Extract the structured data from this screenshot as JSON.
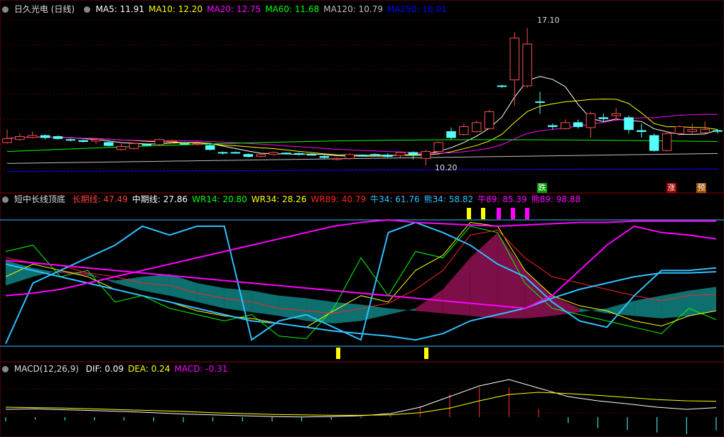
{
  "colors": {
    "ma5": "#ffffff",
    "ma10": "#ffff00",
    "ma20": "#ff00ff",
    "ma60": "#00ff00",
    "ma120": "#c0c0c0",
    "ma250": "#0000ff",
    "up": "#ff5050",
    "down": "#54ffff",
    "grid": "#5a0000",
    "frame": "#8a0000"
  },
  "panel1": {
    "title": "日久光电 (日线)",
    "legend": [
      {
        "label": "MA5: 11.91",
        "color": "#ffffff"
      },
      {
        "label": "MA10: 12.20",
        "color": "#ffff00"
      },
      {
        "label": "MA20: 12.75",
        "color": "#ff00ff"
      },
      {
        "label": "MA60: 11.68",
        "color": "#00ff00"
      },
      {
        "label": "MA120: 10.79",
        "color": "#c0c0c0"
      },
      {
        "label": "MA250: 10.01",
        "color": "#0000ff"
      }
    ],
    "high_label": "17.10",
    "low_label": "10.20",
    "signals": [
      {
        "text": "跌",
        "bg": "#00a000"
      },
      {
        "text": "涨",
        "bg": "#a00000"
      },
      {
        "text": "预",
        "bg": "#a05000"
      }
    ]
  },
  "panel2": {
    "title": "短中长线顶底",
    "legend": [
      {
        "label": "长期线: 47.49",
        "color": "#ff4040"
      },
      {
        "label": "中期线: 27.86",
        "color": "#ffffff"
      },
      {
        "label": "WR14: 20.80",
        "color": "#00ff00"
      },
      {
        "label": "WR34: 28.26",
        "color": "#ffff00"
      },
      {
        "label": "WR89: 40.79",
        "color": "#ff2020"
      },
      {
        "label": "牛34: 61.76",
        "color": "#30c0ff"
      },
      {
        "label": "熊34: 58.82",
        "color": "#30c0ff"
      },
      {
        "label": "牛89: 85.39",
        "color": "#ff00ff"
      },
      {
        "label": "熊89: 98.88",
        "color": "#ff00ff"
      }
    ]
  },
  "panel3": {
    "title": "MACD(12,26,9)",
    "legend": [
      {
        "label": "DIF: 0.09",
        "color": "#ffffff"
      },
      {
        "label": "DEA: 0.24",
        "color": "#ffff00"
      },
      {
        "label": "MACD: -0.31",
        "color": "#ff00ff"
      }
    ]
  },
  "chart_data": [
    {
      "type": "candlestick",
      "title": "日久光电 (日线)",
      "ylim": [
        9.6,
        17.8
      ],
      "candles": [
        {
          "o": 11.35,
          "c": 11.55,
          "h": 12.0,
          "l": 11.3
        },
        {
          "o": 11.5,
          "c": 11.65,
          "h": 11.8,
          "l": 11.45
        },
        {
          "o": 11.6,
          "c": 11.7,
          "h": 11.9,
          "l": 11.55
        },
        {
          "o": 11.7,
          "c": 11.6,
          "h": 11.75,
          "l": 11.5
        },
        {
          "o": 11.65,
          "c": 11.55,
          "h": 11.7,
          "l": 11.5
        },
        {
          "o": 11.5,
          "c": 11.48,
          "h": 11.55,
          "l": 11.4
        },
        {
          "o": 11.45,
          "c": 11.4,
          "h": 11.5,
          "l": 11.35
        },
        {
          "o": 11.42,
          "c": 11.5,
          "h": 11.55,
          "l": 11.3
        },
        {
          "o": 11.35,
          "c": 11.2,
          "h": 11.4,
          "l": 11.15
        },
        {
          "o": 11.0,
          "c": 11.15,
          "h": 11.3,
          "l": 10.95
        },
        {
          "o": 11.05,
          "c": 11.3,
          "h": 11.35,
          "l": 11.0
        },
        {
          "o": 11.25,
          "c": 11.22,
          "h": 11.3,
          "l": 11.2
        },
        {
          "o": 11.25,
          "c": 11.5,
          "h": 11.55,
          "l": 11.2
        },
        {
          "o": 11.4,
          "c": 11.45,
          "h": 11.5,
          "l": 11.3
        },
        {
          "o": 11.3,
          "c": 11.28,
          "h": 11.35,
          "l": 11.25
        },
        {
          "o": 11.25,
          "c": 11.3,
          "h": 11.4,
          "l": 11.2
        },
        {
          "o": 11.2,
          "c": 11.0,
          "h": 11.25,
          "l": 10.95
        },
        {
          "o": 10.85,
          "c": 10.83,
          "h": 10.9,
          "l": 10.75
        },
        {
          "o": 10.85,
          "c": 10.84,
          "h": 10.9,
          "l": 10.8
        },
        {
          "o": 10.75,
          "c": 10.65,
          "h": 10.8,
          "l": 10.6
        },
        {
          "o": 10.65,
          "c": 10.75,
          "h": 10.8,
          "l": 10.6
        },
        {
          "o": 10.75,
          "c": 10.85,
          "h": 10.9,
          "l": 10.7
        },
        {
          "o": 10.82,
          "c": 10.8,
          "h": 10.85,
          "l": 10.75
        },
        {
          "o": 10.8,
          "c": 10.75,
          "h": 10.85,
          "l": 10.7
        },
        {
          "o": 10.75,
          "c": 10.73,
          "h": 10.8,
          "l": 10.7
        },
        {
          "o": 10.65,
          "c": 10.6,
          "h": 10.7,
          "l": 10.55
        },
        {
          "o": 10.5,
          "c": 10.55,
          "h": 10.6,
          "l": 10.45
        },
        {
          "o": 10.55,
          "c": 10.75,
          "h": 10.8,
          "l": 10.5
        },
        {
          "o": 10.72,
          "c": 10.7,
          "h": 10.75,
          "l": 10.65
        },
        {
          "o": 10.75,
          "c": 10.72,
          "h": 10.8,
          "l": 10.7
        },
        {
          "o": 10.72,
          "c": 10.65,
          "h": 10.8,
          "l": 10.6
        },
        {
          "o": 10.7,
          "c": 10.85,
          "h": 10.9,
          "l": 10.6
        },
        {
          "o": 10.85,
          "c": 10.75,
          "h": 10.9,
          "l": 10.5
        },
        {
          "o": 10.55,
          "c": 10.9,
          "h": 11.0,
          "l": 10.2
        },
        {
          "o": 10.9,
          "c": 11.35,
          "h": 11.4,
          "l": 10.85
        },
        {
          "o": 11.9,
          "c": 11.6,
          "h": 12.1,
          "l": 11.5
        },
        {
          "o": 11.75,
          "c": 12.15,
          "h": 12.3,
          "l": 11.7
        },
        {
          "o": 11.9,
          "c": 12.35,
          "h": 12.45,
          "l": 11.85
        },
        {
          "o": 12.05,
          "c": 12.9,
          "h": 13.0,
          "l": 12.0
        },
        {
          "o": 14.2,
          "c": 14.18,
          "h": 14.25,
          "l": 14.1
        },
        {
          "o": 14.5,
          "c": 16.6,
          "h": 16.9,
          "l": 13.2
        },
        {
          "o": 14.2,
          "c": 16.3,
          "h": 17.1,
          "l": 14.1
        },
        {
          "o": 13.4,
          "c": 13.38,
          "h": 13.9,
          "l": 12.8
        },
        {
          "o": 12.2,
          "c": 12.15,
          "h": 12.3,
          "l": 12.0
        },
        {
          "o": 12.05,
          "c": 12.35,
          "h": 12.5,
          "l": 12.0
        },
        {
          "o": 12.35,
          "c": 12.15,
          "h": 12.5,
          "l": 12.05
        },
        {
          "o": 12.1,
          "c": 12.8,
          "h": 12.9,
          "l": 11.6
        },
        {
          "o": 12.6,
          "c": 12.55,
          "h": 12.8,
          "l": 12.4
        },
        {
          "o": 12.7,
          "c": 12.8,
          "h": 13.1,
          "l": 12.5
        },
        {
          "o": 12.6,
          "c": 12.0,
          "h": 12.7,
          "l": 11.8
        },
        {
          "o": 11.95,
          "c": 11.9,
          "h": 12.3,
          "l": 11.6
        },
        {
          "o": 11.7,
          "c": 10.95,
          "h": 11.8,
          "l": 10.9
        },
        {
          "o": 10.95,
          "c": 11.8,
          "h": 11.9,
          "l": 10.9
        },
        {
          "o": 11.8,
          "c": 12.15,
          "h": 12.2,
          "l": 11.7
        },
        {
          "o": 11.9,
          "c": 12.0,
          "h": 12.3,
          "l": 11.8
        },
        {
          "o": 11.85,
          "c": 12.0,
          "h": 12.4,
          "l": 11.8
        },
        {
          "o": 11.95,
          "c": 11.91,
          "h": 12.0,
          "l": 11.8
        }
      ]
    },
    {
      "type": "line",
      "title": "短中长线顶底",
      "ylim": [
        0,
        100
      ],
      "series": [
        {
          "name": "长期线",
          "values": [
            68,
            62,
            58,
            56,
            52,
            55,
            57,
            50,
            46,
            44,
            40,
            38,
            35,
            33,
            30,
            28,
            26,
            24,
            22,
            22,
            24,
            27,
            30,
            36,
            40,
            44,
            47
          ]
        },
        {
          "name": "中期线",
          "values": [
            48,
            55,
            60,
            58,
            50,
            44,
            40,
            35,
            30,
            27,
            24,
            20,
            18,
            20,
            25,
            30,
            45,
            70,
            90,
            60,
            40,
            30,
            26,
            24,
            22,
            24,
            28
          ]
        },
        {
          "name": "WR14",
          "values": [
            75,
            80,
            55,
            60,
            35,
            40,
            30,
            25,
            20,
            25,
            8,
            6,
            30,
            70,
            40,
            75,
            70,
            95,
            90,
            50,
            30,
            25,
            20,
            15,
            10,
            30,
            21
          ]
        },
        {
          "name": "WR34",
          "values": [
            55,
            65,
            60,
            55,
            45,
            40,
            35,
            28,
            24,
            22,
            18,
            15,
            28,
            40,
            35,
            60,
            72,
            98,
            95,
            60,
            40,
            32,
            28,
            20,
            16,
            24,
            28
          ]
        },
        {
          "name": "WR89",
          "values": [
            70,
            66,
            64,
            58,
            55,
            50,
            48,
            42,
            38,
            35,
            30,
            28,
            26,
            30,
            34,
            45,
            60,
            88,
            92,
            70,
            55,
            50,
            45,
            40,
            36,
            40,
            41
          ]
        },
        {
          "name": "牛34",
          "values": [
            2,
            50,
            60,
            70,
            80,
            95,
            88,
            95,
            95,
            5,
            20,
            25,
            15,
            5,
            90,
            98,
            90,
            80,
            65,
            55,
            35,
            20,
            15,
            40,
            60,
            60,
            62
          ]
        },
        {
          "name": "熊34",
          "values": [
            65,
            60,
            55,
            50,
            45,
            40,
            35,
            30,
            25,
            20,
            18,
            15,
            12,
            10,
            8,
            5,
            10,
            20,
            25,
            30,
            38,
            45,
            50,
            55,
            58,
            58,
            59
          ]
        },
        {
          "name": "牛89",
          "values": [
            68,
            66,
            64,
            62,
            60,
            58,
            56,
            54,
            52,
            50,
            48,
            46,
            44,
            42,
            40,
            38,
            36,
            34,
            32,
            30,
            40,
            60,
            80,
            95,
            90,
            88,
            85
          ]
        },
        {
          "name": "熊89",
          "values": [
            40,
            42,
            45,
            50,
            55,
            60,
            65,
            70,
            75,
            80,
            85,
            90,
            95,
            98,
            100,
            98,
            97,
            96,
            95,
            96,
            97,
            98,
            98,
            99,
            99,
            99,
            99
          ]
        }
      ]
    },
    {
      "type": "line",
      "title": "MACD(12,26,9)",
      "series": [
        {
          "name": "DIF",
          "values": [
            0.05,
            0.06,
            0.04,
            0.02,
            0.0,
            -0.03,
            -0.06,
            -0.08,
            -0.1,
            -0.12,
            -0.13,
            -0.12,
            -0.1,
            -0.05,
            0.1,
            0.35,
            0.6,
            0.75,
            0.55,
            0.35,
            0.25,
            0.18,
            0.1,
            0.05,
            0.09
          ]
        },
        {
          "name": "DEA",
          "values": [
            0.1,
            0.09,
            0.08,
            0.06,
            0.04,
            0.02,
            0.0,
            -0.03,
            -0.05,
            -0.07,
            -0.08,
            -0.09,
            -0.09,
            -0.08,
            -0.03,
            0.08,
            0.25,
            0.4,
            0.45,
            0.42,
            0.38,
            0.33,
            0.28,
            0.25,
            0.24
          ]
        },
        {
          "name": "MACD",
          "values": [
            -0.1,
            -0.06,
            -0.08,
            -0.08,
            -0.08,
            -0.1,
            -0.12,
            -0.1,
            -0.1,
            -0.1,
            -0.1,
            -0.06,
            -0.02,
            0.06,
            0.26,
            0.54,
            0.7,
            0.7,
            0.2,
            -0.14,
            -0.26,
            -0.3,
            -0.36,
            -0.4,
            -0.31
          ]
        }
      ]
    }
  ]
}
